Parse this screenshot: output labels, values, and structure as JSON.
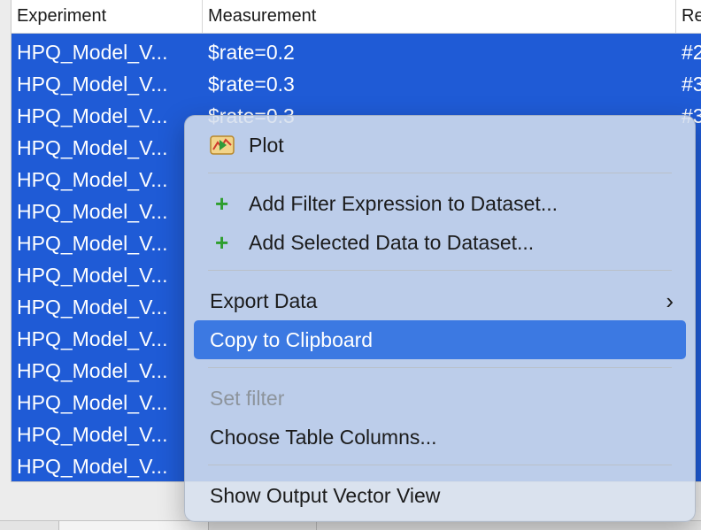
{
  "table": {
    "columns": [
      "Experiment",
      "Measurement",
      "Re"
    ],
    "rows": [
      {
        "experiment": "HPQ_Model_V...",
        "measurement": "$rate=0.2",
        "rep": "#2"
      },
      {
        "experiment": "HPQ_Model_V...",
        "measurement": "$rate=0.3",
        "rep": "#3"
      },
      {
        "experiment": "HPQ_Model_V...",
        "measurement": "$rate=0.3",
        "rep": "#3"
      },
      {
        "experiment": "HPQ_Model_V...",
        "measurement": "",
        "rep": ""
      },
      {
        "experiment": "HPQ_Model_V...",
        "measurement": "",
        "rep": ""
      },
      {
        "experiment": "HPQ_Model_V...",
        "measurement": "",
        "rep": ""
      },
      {
        "experiment": "HPQ_Model_V...",
        "measurement": "",
        "rep": ""
      },
      {
        "experiment": "HPQ_Model_V...",
        "measurement": "",
        "rep": ""
      },
      {
        "experiment": "HPQ_Model_V...",
        "measurement": "",
        "rep": ""
      },
      {
        "experiment": "HPQ_Model_V...",
        "measurement": "",
        "rep": ""
      },
      {
        "experiment": "HPQ_Model_V...",
        "measurement": "",
        "rep": ""
      },
      {
        "experiment": "HPQ_Model_V...",
        "measurement": "",
        "rep": ""
      },
      {
        "experiment": "HPQ_Model_V...",
        "measurement": "",
        "rep": ""
      },
      {
        "experiment": "HPQ_Model_V...",
        "measurement": "",
        "rep": ""
      }
    ]
  },
  "context_menu": {
    "plot": {
      "label": "Plot",
      "icon": "plot-icon"
    },
    "add_filter_expression": {
      "label": "Add Filter Expression to Dataset...",
      "icon": "plus-icon"
    },
    "add_selected_data": {
      "label": "Add Selected Data to Dataset...",
      "icon": "plus-icon"
    },
    "export_data": {
      "label": "Export Data",
      "icon": "chevron-right-icon"
    },
    "copy_to_clipboard": {
      "label": "Copy to Clipboard"
    },
    "set_filter": {
      "label": "Set filter"
    },
    "choose_table_columns": {
      "label": "Choose Table Columns..."
    },
    "show_output_vector_view": {
      "label": "Show Output Vector View"
    }
  },
  "colors": {
    "selection": "#1f5bd6",
    "menu_highlight": "#3c79e2",
    "plus_icon": "#2e9e2e"
  }
}
